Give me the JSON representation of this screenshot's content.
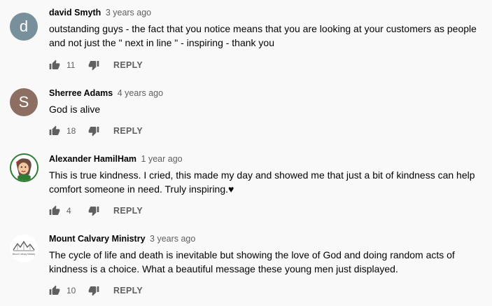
{
  "comments": [
    {
      "author": "david Smyth",
      "time": "3 years ago",
      "avatar_letter": "d",
      "avatar_color": "#78909c",
      "lines": [
        "outstanding guys - the fact that you notice means that you are looking at your customers as people",
        "and not just the \" next in line \" - inspiring - thank you"
      ],
      "likes": "11",
      "reply_label": "REPLY"
    },
    {
      "author": "Sherree Adams",
      "time": "4 years ago",
      "avatar_letter": "S",
      "avatar_color": "#8d6e63",
      "lines": [
        "God is alive"
      ],
      "likes": "18",
      "reply_label": "REPLY"
    },
    {
      "author": "Alexander HamilHam",
      "time": "1 year ago",
      "avatar_color": "#2e7d32",
      "lines": [
        "This is true kindness. I cried, this made my day and showed me that just a bit of kindness can help",
        "comfort someone in need. Truly inspiring.♥"
      ],
      "likes": "4",
      "reply_label": "REPLY"
    },
    {
      "author": "Mount Calvary Ministry",
      "time": "3 years ago",
      "avatar_color": "#ffffff",
      "logo_text": "Mount Calvary Ministry",
      "lines": [
        "The cycle of life and death is inevitable but showing the love of God and doing random acts of",
        "kindness is a choice. What a beautiful message these young men just displayed."
      ],
      "likes": "10",
      "reply_label": "REPLY"
    }
  ],
  "icons": {
    "like": "thumbs-up-icon",
    "dislike": "thumbs-down-icon"
  },
  "colors": {
    "background": "#f9f9f9",
    "icon": "#606060",
    "secondary_text": "#606060"
  }
}
